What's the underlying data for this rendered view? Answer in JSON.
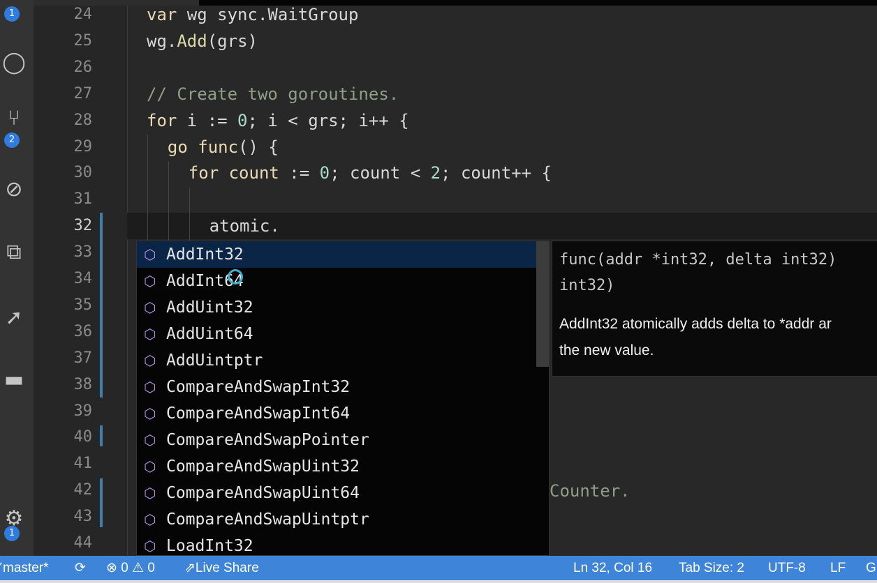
{
  "activity_bar": {
    "badges": {
      "explorer": "1",
      "source_control": "2",
      "settings": "1"
    },
    "icons": [
      "files-icon",
      "search-icon",
      "source-control-icon",
      "debug-icon",
      "extensions-icon",
      "live-share-icon",
      "docker-icon",
      "gear-icon"
    ]
  },
  "editor": {
    "lines": [
      {
        "n": "24",
        "tokens": [
          [
            "var ",
            "kw"
          ],
          [
            "wg sync.WaitGroup",
            "pl"
          ]
        ],
        "indent": 0
      },
      {
        "n": "25",
        "tokens": [
          [
            "wg.",
            "pl"
          ],
          [
            "Add",
            "fn"
          ],
          [
            "(grs)",
            "pl"
          ]
        ],
        "indent": 0
      },
      {
        "n": "26",
        "tokens": [],
        "indent": 0
      },
      {
        "n": "27",
        "tokens": [
          [
            "// Create two goroutines.",
            "cm"
          ]
        ],
        "indent": 0
      },
      {
        "n": "28",
        "tokens": [
          [
            "for ",
            "kw"
          ],
          [
            "i := ",
            "pl"
          ],
          [
            "0",
            "num"
          ],
          [
            "; i < grs; i++ {",
            "pl"
          ]
        ],
        "indent": 0
      },
      {
        "n": "29",
        "tokens": [
          [
            "go ",
            "kw"
          ],
          [
            "func",
            "kw"
          ],
          [
            "() {",
            "pl"
          ]
        ],
        "indent": 2
      },
      {
        "n": "30",
        "tokens": [
          [
            "for ",
            "kw"
          ],
          [
            "count",
            "kw"
          ],
          [
            " := ",
            "pl"
          ],
          [
            "0",
            "num"
          ],
          [
            "; count < ",
            "pl"
          ],
          [
            "2",
            "num"
          ],
          [
            "; count++ {",
            "pl"
          ]
        ],
        "indent": 4
      },
      {
        "n": "31",
        "tokens": [],
        "indent": 0
      },
      {
        "n": "32",
        "tokens": [
          [
            "atomic.",
            "pl"
          ]
        ],
        "indent": 6
      },
      {
        "n": "33",
        "tokens": [],
        "indent": 0
      },
      {
        "n": "34",
        "tokens": [],
        "indent": 0
      },
      {
        "n": "35",
        "tokens": [],
        "indent": 0
      },
      {
        "n": "36",
        "tokens": [],
        "indent": 0
      },
      {
        "n": "37",
        "tokens": [],
        "indent": 0
      },
      {
        "n": "38",
        "tokens": [],
        "indent": 0
      },
      {
        "n": "39",
        "tokens": [],
        "indent": 0
      },
      {
        "n": "40",
        "tokens": [],
        "indent": 0
      },
      {
        "n": "41",
        "tokens": [],
        "indent": 0
      },
      {
        "n": "42",
        "tokens": [],
        "indent": 0
      },
      {
        "n": "43",
        "tokens": [],
        "indent": 0
      },
      {
        "n": "44",
        "tokens": [],
        "indent": 0
      }
    ],
    "line42_visible_fragment": "Counter.",
    "active_line": "32"
  },
  "suggest": {
    "selected": "AddInt32",
    "items": [
      "AddInt32",
      "AddInt64",
      "AddUint32",
      "AddUint64",
      "AddUintptr",
      "CompareAndSwapInt32",
      "CompareAndSwapInt64",
      "CompareAndSwapPointer",
      "CompareAndSwapUint32",
      "CompareAndSwapUint64",
      "CompareAndSwapUintptr",
      "LoadInt32"
    ],
    "item_icon": "cube-icon",
    "signature_line1": "func(addr *int32, delta int32)",
    "signature_line2": "int32)",
    "doc_line1": "AddInt32 atomically adds delta to *addr ar",
    "doc_line2": "the new value."
  },
  "status_bar": {
    "branch": "master*",
    "errors": "0",
    "warnings": "0",
    "live_share": "Live Share",
    "position": "Ln 32, Col 16",
    "tab_size": "Tab Size: 2",
    "encoding": "UTF-8",
    "eol": "LF",
    "language_fragment": "G"
  },
  "colors": {
    "status_bar": "#3e85d9",
    "selected_suggestion": "#0b2547",
    "keyword": "#eadbb4",
    "function": "#dcdcaa",
    "number": "#a9dccd",
    "comment": "#8f9f86",
    "suggestion_icon": "#b48ee8"
  }
}
